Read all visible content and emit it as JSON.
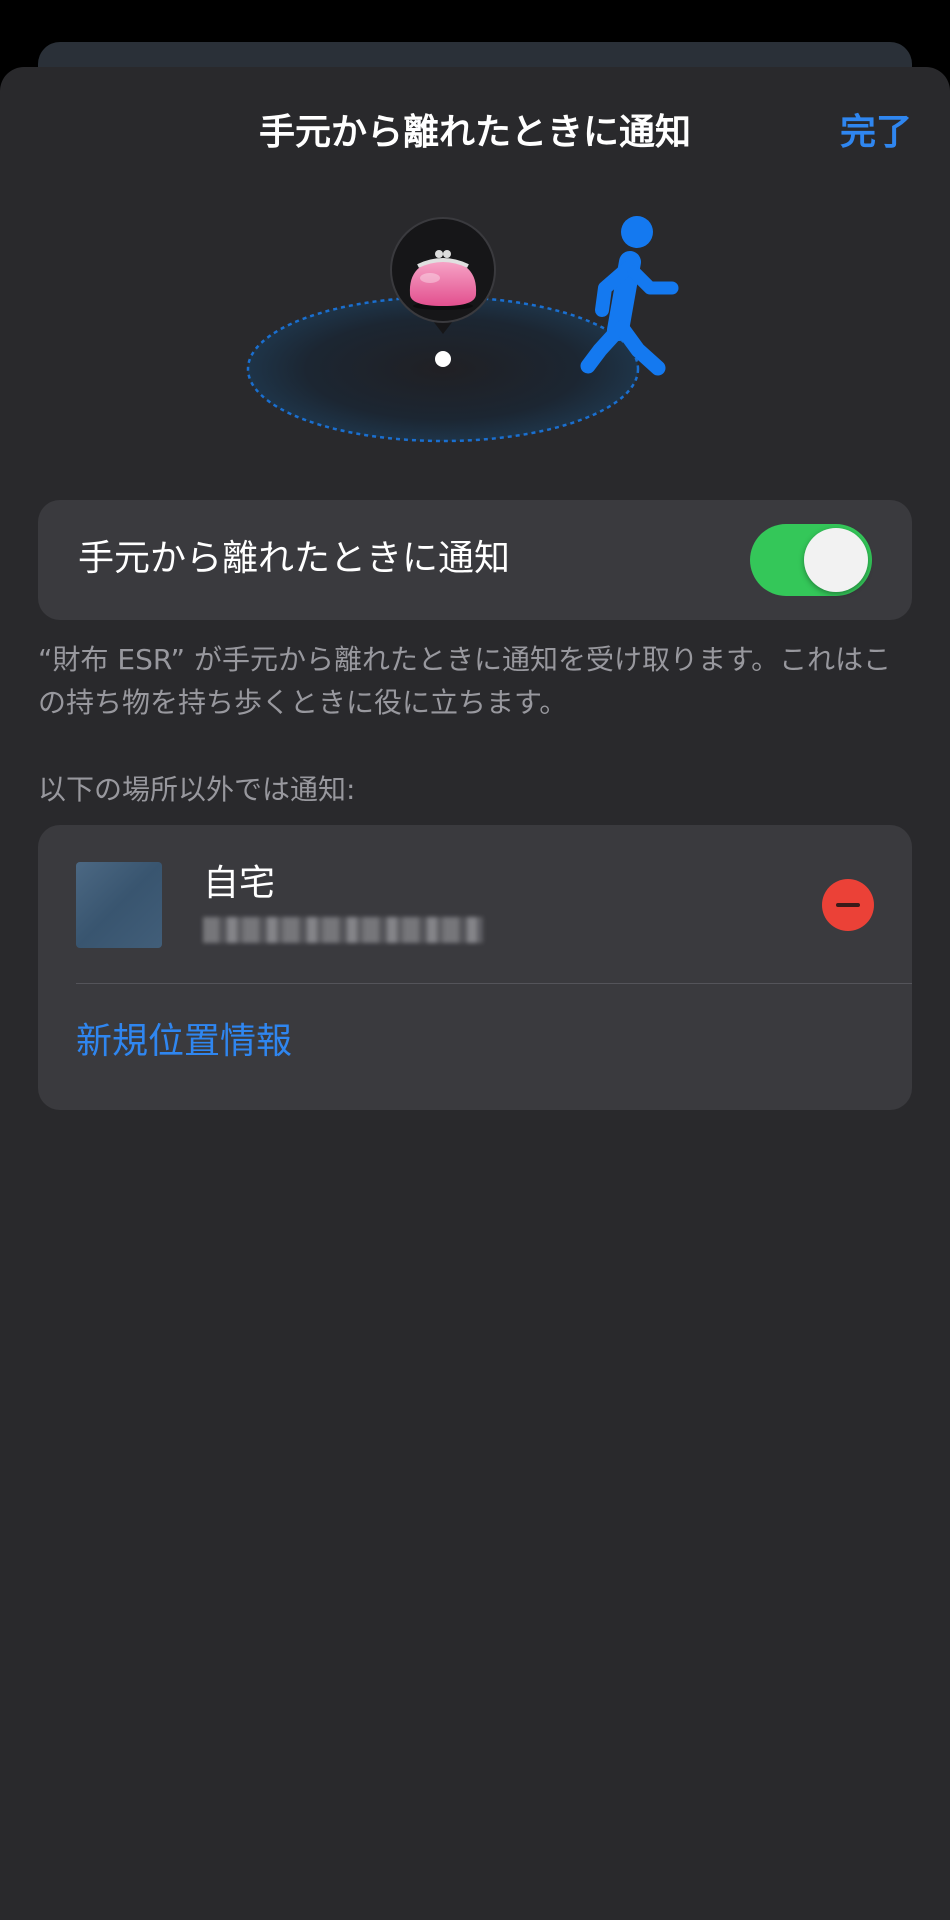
{
  "header": {
    "title": "手元から離れたときに通知",
    "done_label": "完了"
  },
  "toggle": {
    "label": "手元から離れたときに通知",
    "state": "on",
    "on_color": "#34c759"
  },
  "description": "“財布 ESR” が手元から離れたときに通知を受け取ります。これはこの持ち物を持ち歩くときに役に立ちます。",
  "exceptions": {
    "section_header": "以下の場所以外では通知:",
    "locations": [
      {
        "name": "自宅",
        "icon": "map-thumbnail"
      }
    ],
    "add_label": "新規位置情報"
  },
  "illustration": {
    "item_icon": "purse-icon",
    "person_icon": "walking-person-icon"
  },
  "colors": {
    "accent": "#2f86f0",
    "sheet_bg": "#29292c",
    "card_bg": "#3a3a3e",
    "delete_red": "#eb4137",
    "secondary_text": "#98989e"
  }
}
